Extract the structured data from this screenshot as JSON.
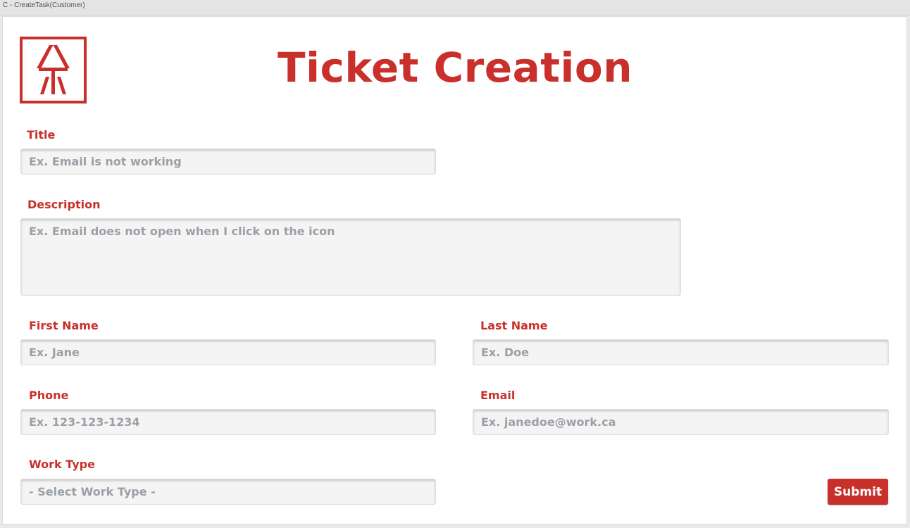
{
  "window": {
    "title": "C - CreateTask(Customer)"
  },
  "header": {
    "title": "Ticket Creation",
    "logo_icon": "company-logo-icon"
  },
  "form": {
    "title": {
      "label": "Title",
      "placeholder": "Ex. Email is not working"
    },
    "description": {
      "label": "Description",
      "placeholder": "Ex. Email does not open when I click on the icon"
    },
    "first_name": {
      "label": "First Name",
      "placeholder": "Ex. Jane"
    },
    "last_name": {
      "label": "Last Name",
      "placeholder": "Ex. Doe"
    },
    "phone": {
      "label": "Phone",
      "placeholder": "Ex. 123-123-1234"
    },
    "email": {
      "label": "Email",
      "placeholder": "Ex. janedoe@work.ca"
    },
    "work_type": {
      "label": "Work Type",
      "selected": "- Select Work Type -"
    },
    "submit_label": "Submit"
  },
  "colors": {
    "accent": "#c9302c",
    "field_bg": "#f4f4f4",
    "placeholder": "#9aa0a6"
  }
}
